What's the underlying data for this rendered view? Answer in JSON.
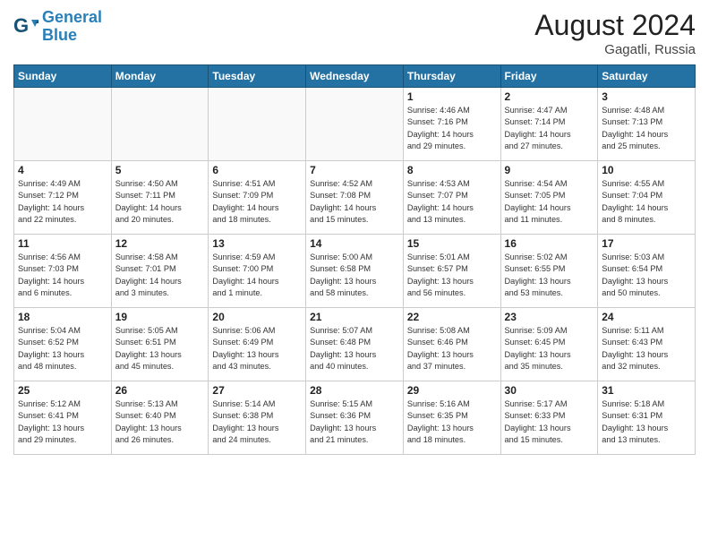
{
  "header": {
    "logo_line1": "General",
    "logo_line2": "Blue",
    "month": "August 2024",
    "location": "Gagatli, Russia"
  },
  "weekdays": [
    "Sunday",
    "Monday",
    "Tuesday",
    "Wednesday",
    "Thursday",
    "Friday",
    "Saturday"
  ],
  "weeks": [
    [
      {
        "day": "",
        "info": ""
      },
      {
        "day": "",
        "info": ""
      },
      {
        "day": "",
        "info": ""
      },
      {
        "day": "",
        "info": ""
      },
      {
        "day": "1",
        "info": "Sunrise: 4:46 AM\nSunset: 7:16 PM\nDaylight: 14 hours\nand 29 minutes."
      },
      {
        "day": "2",
        "info": "Sunrise: 4:47 AM\nSunset: 7:14 PM\nDaylight: 14 hours\nand 27 minutes."
      },
      {
        "day": "3",
        "info": "Sunrise: 4:48 AM\nSunset: 7:13 PM\nDaylight: 14 hours\nand 25 minutes."
      }
    ],
    [
      {
        "day": "4",
        "info": "Sunrise: 4:49 AM\nSunset: 7:12 PM\nDaylight: 14 hours\nand 22 minutes."
      },
      {
        "day": "5",
        "info": "Sunrise: 4:50 AM\nSunset: 7:11 PM\nDaylight: 14 hours\nand 20 minutes."
      },
      {
        "day": "6",
        "info": "Sunrise: 4:51 AM\nSunset: 7:09 PM\nDaylight: 14 hours\nand 18 minutes."
      },
      {
        "day": "7",
        "info": "Sunrise: 4:52 AM\nSunset: 7:08 PM\nDaylight: 14 hours\nand 15 minutes."
      },
      {
        "day": "8",
        "info": "Sunrise: 4:53 AM\nSunset: 7:07 PM\nDaylight: 14 hours\nand 13 minutes."
      },
      {
        "day": "9",
        "info": "Sunrise: 4:54 AM\nSunset: 7:05 PM\nDaylight: 14 hours\nand 11 minutes."
      },
      {
        "day": "10",
        "info": "Sunrise: 4:55 AM\nSunset: 7:04 PM\nDaylight: 14 hours\nand 8 minutes."
      }
    ],
    [
      {
        "day": "11",
        "info": "Sunrise: 4:56 AM\nSunset: 7:03 PM\nDaylight: 14 hours\nand 6 minutes."
      },
      {
        "day": "12",
        "info": "Sunrise: 4:58 AM\nSunset: 7:01 PM\nDaylight: 14 hours\nand 3 minutes."
      },
      {
        "day": "13",
        "info": "Sunrise: 4:59 AM\nSunset: 7:00 PM\nDaylight: 14 hours\nand 1 minute."
      },
      {
        "day": "14",
        "info": "Sunrise: 5:00 AM\nSunset: 6:58 PM\nDaylight: 13 hours\nand 58 minutes."
      },
      {
        "day": "15",
        "info": "Sunrise: 5:01 AM\nSunset: 6:57 PM\nDaylight: 13 hours\nand 56 minutes."
      },
      {
        "day": "16",
        "info": "Sunrise: 5:02 AM\nSunset: 6:55 PM\nDaylight: 13 hours\nand 53 minutes."
      },
      {
        "day": "17",
        "info": "Sunrise: 5:03 AM\nSunset: 6:54 PM\nDaylight: 13 hours\nand 50 minutes."
      }
    ],
    [
      {
        "day": "18",
        "info": "Sunrise: 5:04 AM\nSunset: 6:52 PM\nDaylight: 13 hours\nand 48 minutes."
      },
      {
        "day": "19",
        "info": "Sunrise: 5:05 AM\nSunset: 6:51 PM\nDaylight: 13 hours\nand 45 minutes."
      },
      {
        "day": "20",
        "info": "Sunrise: 5:06 AM\nSunset: 6:49 PM\nDaylight: 13 hours\nand 43 minutes."
      },
      {
        "day": "21",
        "info": "Sunrise: 5:07 AM\nSunset: 6:48 PM\nDaylight: 13 hours\nand 40 minutes."
      },
      {
        "day": "22",
        "info": "Sunrise: 5:08 AM\nSunset: 6:46 PM\nDaylight: 13 hours\nand 37 minutes."
      },
      {
        "day": "23",
        "info": "Sunrise: 5:09 AM\nSunset: 6:45 PM\nDaylight: 13 hours\nand 35 minutes."
      },
      {
        "day": "24",
        "info": "Sunrise: 5:11 AM\nSunset: 6:43 PM\nDaylight: 13 hours\nand 32 minutes."
      }
    ],
    [
      {
        "day": "25",
        "info": "Sunrise: 5:12 AM\nSunset: 6:41 PM\nDaylight: 13 hours\nand 29 minutes."
      },
      {
        "day": "26",
        "info": "Sunrise: 5:13 AM\nSunset: 6:40 PM\nDaylight: 13 hours\nand 26 minutes."
      },
      {
        "day": "27",
        "info": "Sunrise: 5:14 AM\nSunset: 6:38 PM\nDaylight: 13 hours\nand 24 minutes."
      },
      {
        "day": "28",
        "info": "Sunrise: 5:15 AM\nSunset: 6:36 PM\nDaylight: 13 hours\nand 21 minutes."
      },
      {
        "day": "29",
        "info": "Sunrise: 5:16 AM\nSunset: 6:35 PM\nDaylight: 13 hours\nand 18 minutes."
      },
      {
        "day": "30",
        "info": "Sunrise: 5:17 AM\nSunset: 6:33 PM\nDaylight: 13 hours\nand 15 minutes."
      },
      {
        "day": "31",
        "info": "Sunrise: 5:18 AM\nSunset: 6:31 PM\nDaylight: 13 hours\nand 13 minutes."
      }
    ]
  ]
}
